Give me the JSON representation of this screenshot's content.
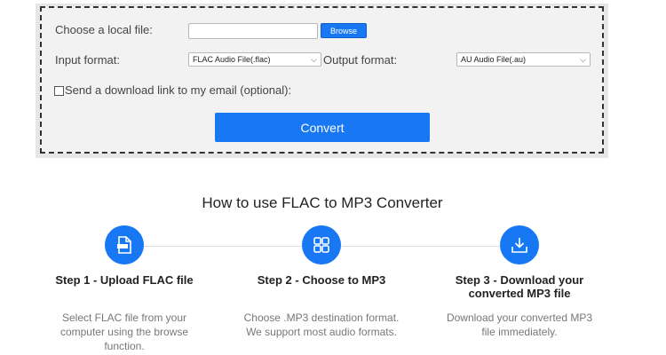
{
  "form": {
    "choose_file_label": "Choose a local file:",
    "file_value": "",
    "browse_label": "Browse",
    "input_format_label": "Input format:",
    "input_format_value": "FLAC Audio File(.flac)",
    "output_format_label": "Output format:",
    "output_format_value": "AU Audio File(.au)",
    "email_label": "Send a download link to my email (optional):",
    "email_checked": false,
    "convert_label": "Convert"
  },
  "howto": {
    "title": "How to use FLAC to MP3 Converter",
    "steps": [
      {
        "icon": "file-upload-icon",
        "title": "Step 1 - Upload FLAC file",
        "desc_line1": "Select FLAC file from your",
        "desc_line2": "computer using the browse",
        "desc_line3": "function."
      },
      {
        "icon": "grid-icon",
        "title": "Step 2 - Choose to MP3",
        "desc_line1": "Choose .MP3 destination format.",
        "desc_line2": "We support most audio formats."
      },
      {
        "icon": "download-icon",
        "title_line1": "Step 3 - Download your",
        "title_line2": "converted MP3 file",
        "desc_line1": "Download your converted MP3",
        "desc_line2": "file immediately."
      }
    ]
  },
  "colors": {
    "accent": "#1877f2",
    "panel_bg": "#f2f2f2",
    "muted_text": "#777777"
  }
}
